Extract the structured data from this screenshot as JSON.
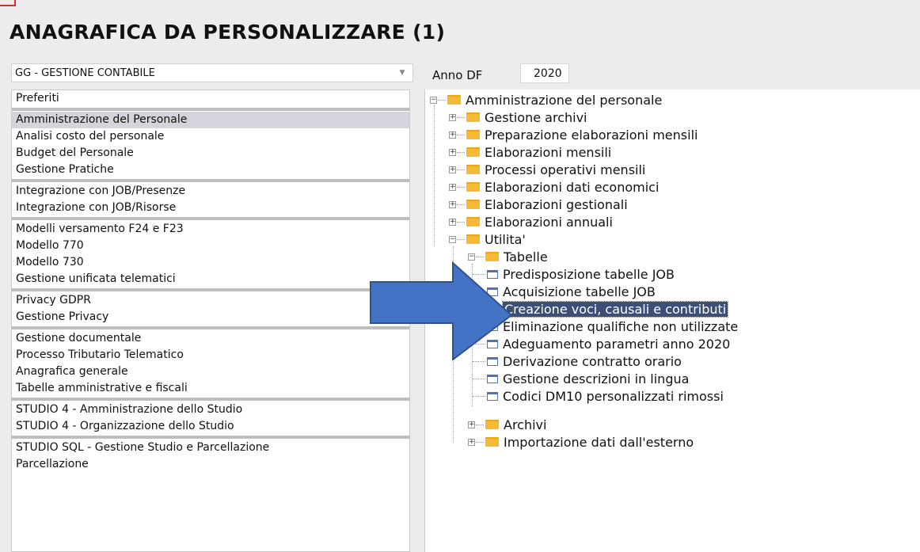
{
  "title": "ANAGRAFICA DA PERSONALIZZARE (1)",
  "combo": {
    "value": "GG - GESTIONE CONTABILE"
  },
  "year": {
    "label": "Anno DF",
    "value": "2020"
  },
  "left_list": [
    "Preferiti",
    "Amministrazione del Personale",
    "Analisi costo del personale",
    "Budget del Personale",
    "Gestione Pratiche",
    "Integrazione con JOB/Presenze",
    "Integrazione con JOB/Risorse",
    "Modelli versamento F24 e F23",
    "Modello 770",
    "Modello 730",
    "Gestione unificata telematici",
    "Privacy GDPR",
    "Gestione Privacy",
    "Gestione documentale",
    "Processo Tributario Telematico",
    "Anagrafica generale",
    "Tabelle amministrative e fiscali",
    "STUDIO 4 - Amministrazione dello Studio",
    "STUDIO 4 - Organizzazione dello Studio",
    "STUDIO SQL - Gestione Studio e Parcellazione",
    "Parcellazione"
  ],
  "selected_left": "Amministrazione del Personale",
  "tree": {
    "root": "Amministrazione del personale",
    "level1": [
      "Gestione archivi",
      "Preparazione elaborazioni mensili",
      "Elaborazioni mensili",
      "Processi operativi mensili",
      "Elaborazioni dati economici",
      "Elaborazioni gestionali",
      "Elaborazioni annuali",
      "Utilita'"
    ],
    "utilita_children": {
      "tabelle": "Tabelle",
      "archivi": "Archivi",
      "importazione": "Importazione dati dall'esterno"
    },
    "tabelle_items": [
      "Predisposizione tabelle JOB",
      "Acquisizione tabelle JOB",
      "Creazione voci, causali e contributi",
      "Eliminazione qualifiche non utilizzate",
      "Adeguamento parametri anno 2020",
      "Derivazione contratto orario",
      "Gestione descrizioni in lingua",
      "Codici DM10 personalizzati rimossi"
    ],
    "selected_item": "Creazione voci, causali e contributi"
  },
  "colors": {
    "arrow": "#4472c4",
    "selection": "#3d4f77",
    "folder": "#f5b935"
  },
  "icons": {
    "folder": "folder-icon",
    "page": "page-icon",
    "expand": "plus-box-icon",
    "collapse": "minus-box-icon"
  }
}
